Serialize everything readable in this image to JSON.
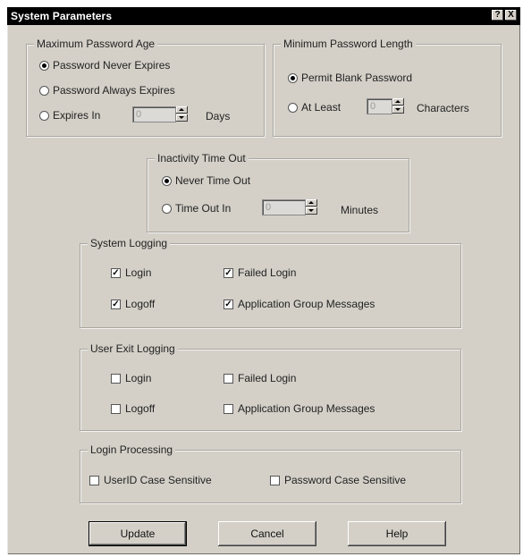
{
  "window": {
    "title": "System Parameters",
    "help_button": "?",
    "close_button": "X"
  },
  "max_password_age": {
    "legend": "Maximum Password Age",
    "options": [
      {
        "label": "Password Never Expires",
        "selected": true
      },
      {
        "label": "Password Always Expires",
        "selected": false
      },
      {
        "label": "Expires In",
        "selected": false
      }
    ],
    "days_value": "0",
    "days_unit": "Days"
  },
  "min_password_length": {
    "legend": "Minimum Password Length",
    "options": [
      {
        "label": "Permit Blank Password",
        "selected": true
      },
      {
        "label": "At Least",
        "selected": false
      }
    ],
    "characters_value": "0",
    "characters_unit": "Characters"
  },
  "inactivity_timeout": {
    "legend": "Inactivity Time Out",
    "options": [
      {
        "label": "Never Time Out",
        "selected": true
      },
      {
        "label": "Time Out In",
        "selected": false
      }
    ],
    "minutes_value": "0",
    "minutes_unit": "Minutes"
  },
  "system_logging": {
    "legend": "System Logging",
    "items": [
      {
        "label": "Login",
        "checked": true
      },
      {
        "label": "Failed Login",
        "checked": true
      },
      {
        "label": "Logoff",
        "checked": true
      },
      {
        "label": "Application Group Messages",
        "checked": true
      }
    ]
  },
  "user_exit_logging": {
    "legend": "User Exit Logging",
    "items": [
      {
        "label": "Login",
        "checked": false
      },
      {
        "label": "Failed Login",
        "checked": false
      },
      {
        "label": "Logoff",
        "checked": false
      },
      {
        "label": "Application Group Messages",
        "checked": false
      }
    ]
  },
  "login_processing": {
    "legend": "Login Processing",
    "items": [
      {
        "label": "UserID Case Sensitive",
        "checked": false
      },
      {
        "label": "Password Case Sensitive",
        "checked": false
      }
    ]
  },
  "buttons": {
    "update": "Update",
    "cancel": "Cancel",
    "help": "Help"
  }
}
